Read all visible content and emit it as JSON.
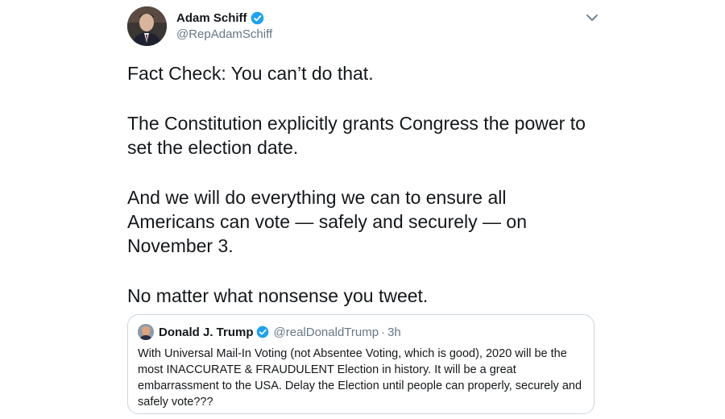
{
  "tweet": {
    "author": {
      "name": "Adam Schiff",
      "handle": "@RepAdamSchiff"
    },
    "paragraphs": [
      "Fact Check: You can’t do that.",
      "The Constitution explicitly grants Congress the power to set the election date.",
      "And we will do everything we can to ensure all Americans can vote — safely and securely — on November 3.",
      "No matter what nonsense you tweet."
    ]
  },
  "quoted_tweet": {
    "author": {
      "name": "Donald J. Trump",
      "handle": "@realDonaldTrump"
    },
    "separator": "·",
    "time": "3h",
    "text": "With Universal Mail-In Voting (not Absentee Voting, which is good), 2020 will be the most INACCURATE & FRAUDULENT Election in history. It will be a great embarrassment to the USA. Delay the Election until people can properly, securely and safely vote???"
  },
  "icons": {
    "verified": "verified-badge-icon",
    "menu": "chevron-down-icon"
  },
  "colors": {
    "verified_blue": "#1da1f2",
    "secondary_text": "#657786",
    "border": "#ccd6dd"
  }
}
